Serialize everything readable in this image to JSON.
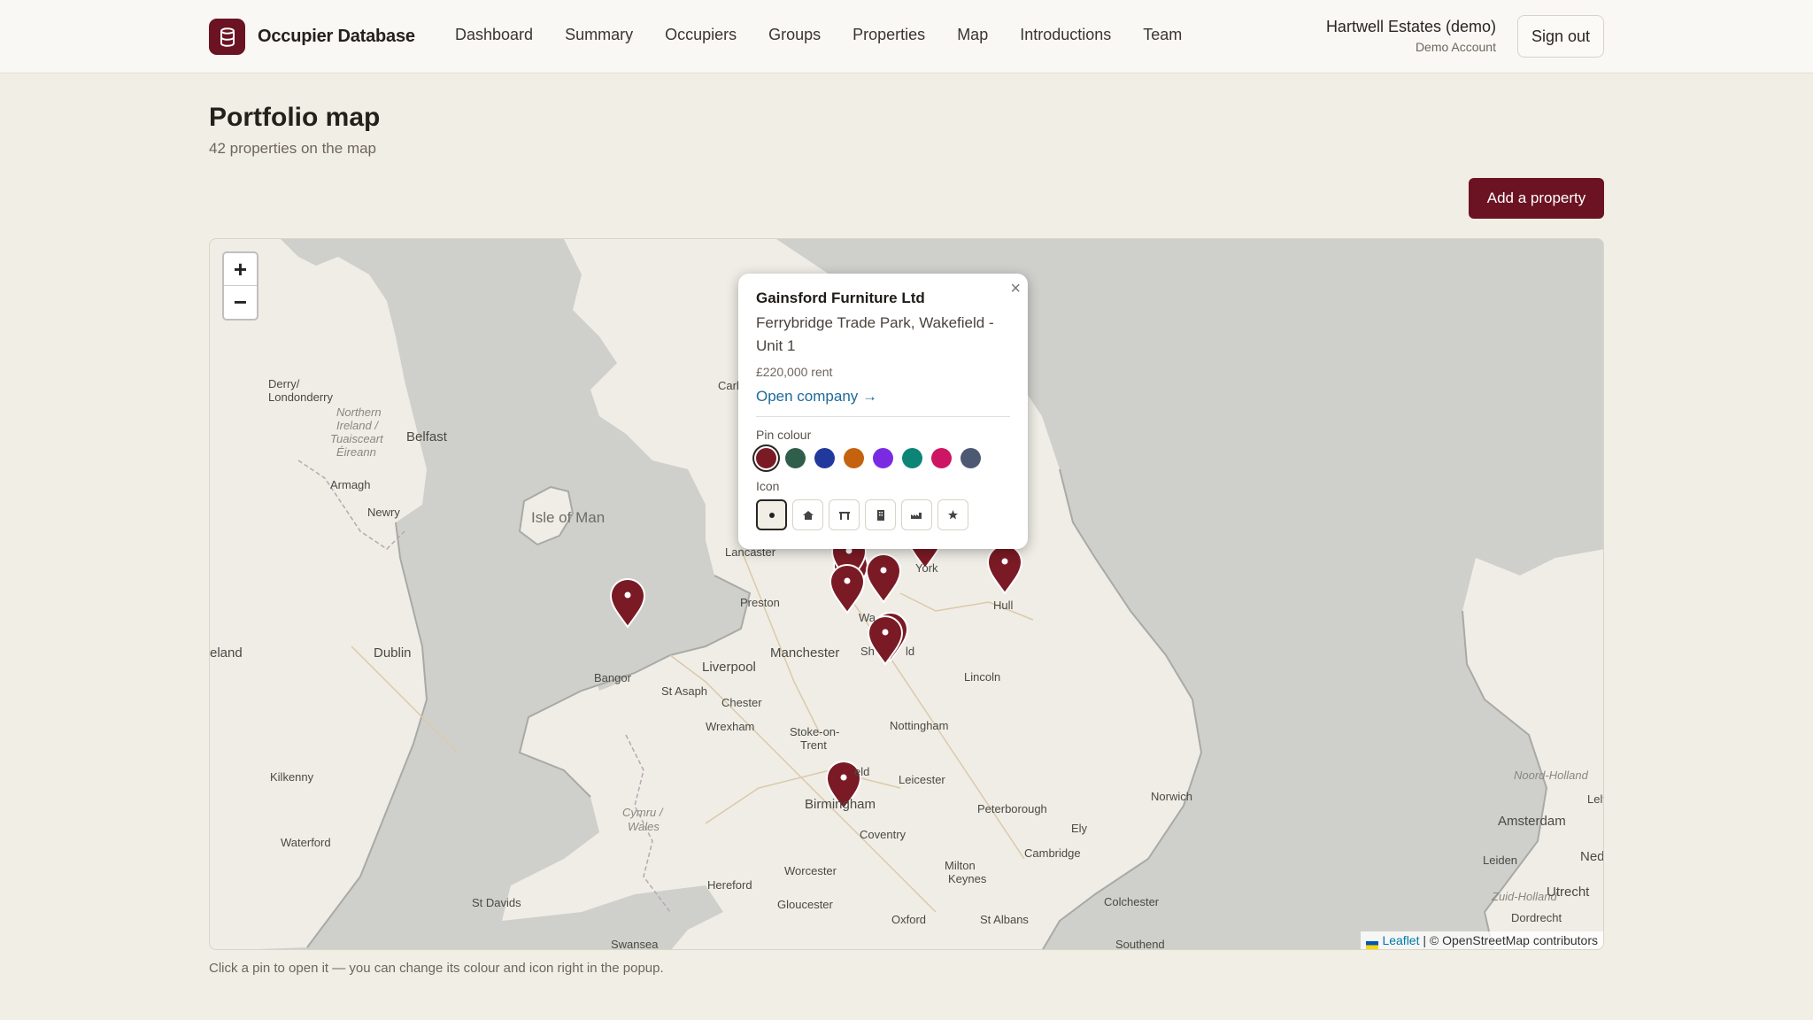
{
  "header": {
    "brand": "Occupier Database",
    "nav": [
      "Dashboard",
      "Summary",
      "Occupiers",
      "Groups",
      "Properties",
      "Map",
      "Introductions",
      "Team"
    ],
    "account_name": "Hartwell Estates (demo)",
    "account_sub": "Demo Account",
    "signout_label": "Sign out"
  },
  "page": {
    "title": "Portfolio map",
    "subtitle": "42 properties on the map",
    "add_button": "Add a property",
    "hint": "Click a pin to open it — you can change its colour and icon right in the popup."
  },
  "map": {
    "zoom_in": "+",
    "zoom_out": "−",
    "attribution_link": "Leaflet",
    "attribution_text": "| © OpenStreetMap contributors",
    "pin_color": "#7a1a24",
    "places": [
      "Derry/\nLondonderry",
      "Northern",
      "Ireland /",
      "Tuaisceart",
      "Éireann",
      "Belfast",
      "Armagh",
      "Newry",
      "Isle of Man",
      "Dublin",
      "eland",
      "Kilkenny",
      "Waterford",
      "Carl",
      "Lancaster",
      "Preston",
      "York",
      "Hull",
      "Manchester",
      "Liverpool",
      "Bangor",
      "St Asaph",
      "Chester",
      "Wrexham",
      "Lincoln",
      "Stoke-on-",
      "Trent",
      "Nottingham",
      "Leicester",
      "Birmingham",
      "Peterborough",
      "Norwich",
      "Coventry",
      "Cymru /",
      "Wales",
      "Ely",
      "Worcester",
      "Cambridge",
      "Milton",
      "Keynes",
      "Hereford",
      "Gloucester",
      "Colchester",
      "St Davids",
      "Oxford",
      "St Albans",
      "Southend",
      "Swansea",
      "Noord-Holland",
      "Lely",
      "Amsterdam",
      "Leiden",
      "Ned",
      "Zuid-Holland",
      "Utrecht",
      "Dordrecht",
      "Wa",
      "Sh",
      "ld",
      "eld"
    ]
  },
  "popup": {
    "title": "Gainsford Furniture Ltd",
    "address": "Ferrybridge Trade Park, Wakefield - Unit 1",
    "rent": "£220,000 rent",
    "link": "Open company →",
    "colour_label": "Pin colour",
    "colours": [
      "#7a1a24",
      "#2f5e4a",
      "#21399c",
      "#c5620e",
      "#7a2be2",
      "#0c8577",
      "#cc1663",
      "#4d5873"
    ],
    "selected_colour": 0,
    "icon_label": "Icon",
    "icons": [
      "dot-icon",
      "home-icon",
      "store-icon",
      "office-icon",
      "factory-icon",
      "star-icon"
    ],
    "selected_icon": 0,
    "close_label": "×"
  }
}
